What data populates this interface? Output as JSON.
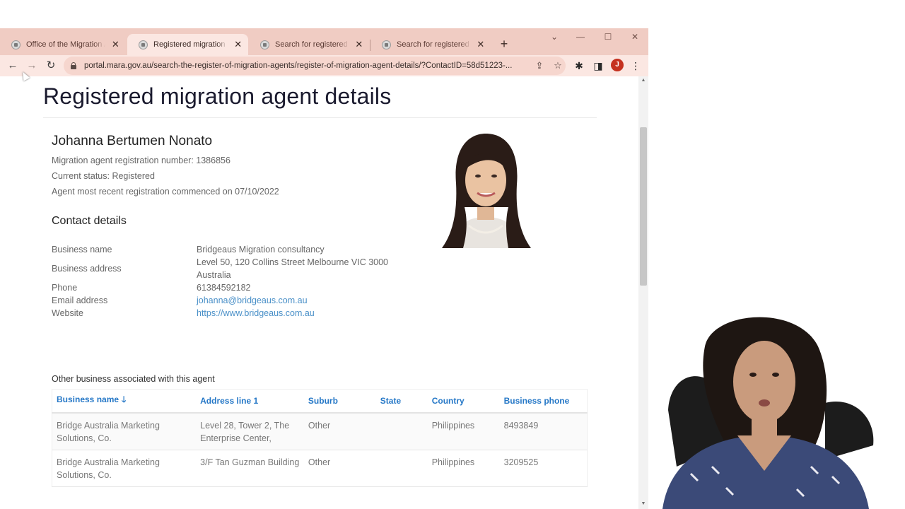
{
  "browser": {
    "tabs": [
      {
        "title": "Office of the Migration Agents Registration Authority",
        "active": false
      },
      {
        "title": "Registered migration agent details",
        "active": true
      },
      {
        "title": "Search for registered migration agents",
        "active": false
      },
      {
        "title": "Search for registered migration agents",
        "active": false
      }
    ],
    "new_tab_icon": "plus-icon",
    "window_controls": [
      "chevron-down-icon",
      "minimize-icon",
      "maximize-icon",
      "close-icon"
    ],
    "url": "portal.mara.gov.au/search-the-register-of-migration-agents/register-of-migration-agent-details/?ContactID=58d51223-...",
    "profile_initial": "J",
    "accent_color": "#f0ccc3"
  },
  "page": {
    "title": "Registered migration agent details",
    "agent": {
      "name": "Johanna Bertumen Nonato",
      "registration_line": "Migration agent registration number:  1386856",
      "status_line": "Current status:  Registered",
      "commenced_line": "Agent most recent registration commenced on 07/10/2022"
    },
    "contact": {
      "heading": "Contact details",
      "business_name_label": "Business name",
      "business_name": "Bridgeaus Migration consultancy",
      "business_address_label": "Business address",
      "business_address_line1": "Level 50, 120 Collins Street Melbourne VIC 3000",
      "business_address_line2": "Australia",
      "phone_label": "Phone",
      "phone": "61384592182",
      "email_label": "Email address",
      "email": "johanna@bridgeaus.com.au",
      "website_label": "Website",
      "website": "https://www.bridgeaus.com.au"
    },
    "other_business": {
      "heading": "Other business associated with this agent",
      "columns": [
        "Business name",
        "Address line 1",
        "Suburb",
        "State",
        "Country",
        "Business phone"
      ],
      "rows": [
        {
          "name_l1": "Bridge Australia Marketing",
          "name_l2": "Solutions, Co.",
          "addr_l1": "Level 28, Tower 2, The",
          "addr_l2": "Enterprise Center,",
          "suburb": "Other",
          "state": "",
          "country": "Philippines",
          "phone": "8493849"
        },
        {
          "name_l1": "Bridge Australia Marketing",
          "name_l2": "Solutions, Co.",
          "addr_l1": "3/F Tan Guzman Building",
          "addr_l2": "",
          "suburb": "Other",
          "state": "",
          "country": "Philippines",
          "phone": "3209525"
        }
      ]
    }
  }
}
